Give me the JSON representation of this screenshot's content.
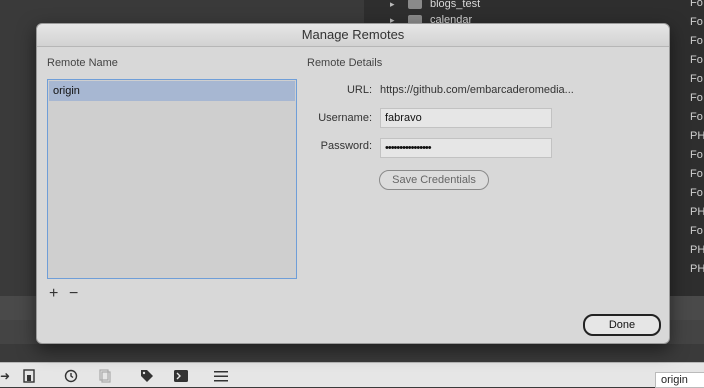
{
  "background": {
    "tree_items": [
      {
        "label": "blogs_test"
      },
      {
        "label": "calendar"
      }
    ],
    "kind_column": [
      "Fo",
      "Fo",
      "Fo",
      "Fo",
      "Fo",
      "Fo",
      "Fo",
      "PH",
      "Fo",
      "Fo",
      "Fo",
      "PH",
      "Fo",
      "PH",
      "PH"
    ],
    "branch": "origin"
  },
  "dialog": {
    "title": "Manage Remotes",
    "remote_name_header": "Remote Name",
    "remote_details_header": "Remote Details",
    "remotes": [
      {
        "name": "origin",
        "selected": true
      }
    ],
    "add_symbol": "+",
    "remove_symbol": "−",
    "url_label": "URL:",
    "url_value": "https://github.com/embarcaderomedia...",
    "username_label": "Username:",
    "username_value": "fabravo",
    "password_label": "Password:",
    "password_value": "••••••••••••••••",
    "save_label": "Save Credentials",
    "done_label": "Done"
  },
  "colors": {
    "selection": "#a7b7d2",
    "list_focus_border": "#6f9ed8"
  }
}
